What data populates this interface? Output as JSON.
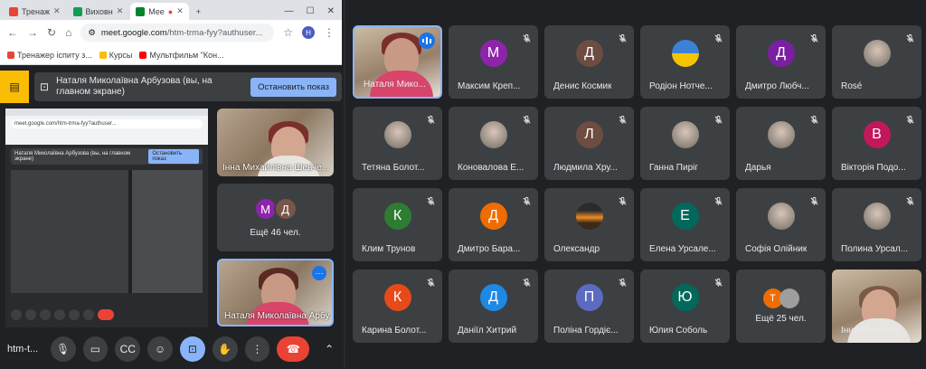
{
  "browser": {
    "tabs": [
      {
        "label": "Тренаж",
        "color": "#ea4335",
        "active": false
      },
      {
        "label": "Виховн",
        "color": "#0f9d58",
        "active": false
      },
      {
        "label": "Mee",
        "color": "#00832d",
        "active": true
      }
    ],
    "url_main": "meet.google.com",
    "url_rest": "/htm-trma-fyy?authuser...",
    "profile_initial": "H",
    "bookmarks": [
      {
        "label": "Тренажер іспиту з...",
        "color": "#ea4335"
      },
      {
        "label": "Курсы",
        "color": "#fbbc04"
      },
      {
        "label": "Мультфильм \"Кон...",
        "color": "#ff0000"
      }
    ]
  },
  "presentation": {
    "text": "Наталя Миколаївна Арбузова (вы, на главном экране)",
    "stop_label": "Остановить показ"
  },
  "nested": {
    "mini_url": "meet.google.com/htm-trma-fyy?authuser...",
    "mini_present_text": "Наталя Миколаївна Арбузова (вы, на главном экране)",
    "mini_stop": "Остановить показ"
  },
  "side": {
    "tile1_name": "Інна Михайлівна Шевче...",
    "more_label": "Ещё 46 чел.",
    "more_avatars": [
      {
        "letter": "М",
        "color": "#8e24aa"
      },
      {
        "letter": "Д",
        "color": "#795548"
      }
    ],
    "tile3_name": "Наталя Миколаївна Арбу...",
    "more_icon": "more-vert-icon"
  },
  "controls": {
    "meeting_code": "htm-t...",
    "buttons": [
      "mic-icon",
      "camera-icon",
      "captions-icon",
      "emoji-icon",
      "present-icon",
      "hand-icon",
      "more-icon",
      "end-call-icon",
      "chevron-up-icon"
    ]
  },
  "participants": [
    {
      "name": "Наталя Мико...",
      "type": "photo",
      "highlight": true,
      "speaking": true
    },
    {
      "name": "Максим Креп...",
      "letter": "М",
      "color": "#8e24aa"
    },
    {
      "name": "Денис Космик",
      "letter": "Д",
      "color": "#6d4c41"
    },
    {
      "name": "Родіон Нотче...",
      "type": "flag"
    },
    {
      "name": "Дмитро Любч...",
      "letter": "Д",
      "color": "#7b1fa2"
    },
    {
      "name": "Rosé",
      "type": "img"
    },
    {
      "name": "Тетяна Болот...",
      "type": "img"
    },
    {
      "name": "Коновалова Е...",
      "type": "img"
    },
    {
      "name": "Людмила Хру...",
      "letter": "Л",
      "color": "#6d4c41"
    },
    {
      "name": "Ганна Пиріг",
      "type": "img"
    },
    {
      "name": "Дарья",
      "type": "img"
    },
    {
      "name": "Вікторія Подо...",
      "letter": "В",
      "color": "#c2185b"
    },
    {
      "name": "Клим Трунов",
      "letter": "К",
      "color": "#2e7d32"
    },
    {
      "name": "Дмитро Бара...",
      "letter": "Д",
      "color": "#ef6c00"
    },
    {
      "name": "Олександр",
      "type": "sunset"
    },
    {
      "name": "Елена Урсале...",
      "letter": "Е",
      "color": "#00695c"
    },
    {
      "name": "Софія Олійник",
      "type": "img"
    },
    {
      "name": "Полина Урсал...",
      "type": "img"
    },
    {
      "name": "Карина Болот...",
      "letter": "К",
      "color": "#e64a19"
    },
    {
      "name": "Даніїл Хитрий",
      "letter": "Д",
      "color": "#1e88e5"
    },
    {
      "name": "Поліна Гордіє...",
      "letter": "П",
      "color": "#5c6bc0"
    },
    {
      "name": "Юлия Соболь",
      "letter": "Ю",
      "color": "#00695c"
    },
    {
      "name": "",
      "type": "more",
      "label": "Ещё 25 чел.",
      "pair": [
        {
          "letter": "Т",
          "color": "#ef6c00"
        },
        {
          "letter": "",
          "color": "#9e9e9e"
        }
      ]
    },
    {
      "name": "Інна Михайлів...",
      "type": "photo2"
    }
  ]
}
